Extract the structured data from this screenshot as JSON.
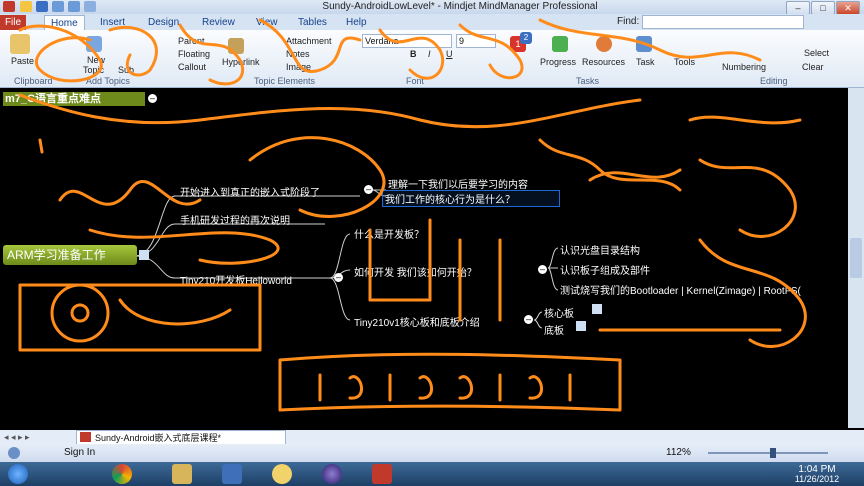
{
  "window": {
    "title": "Sundy-AndroidLowLevel* - Mindjet MindManager Professional",
    "buttons": [
      "–",
      "□",
      "✕"
    ]
  },
  "ribbon": {
    "tabs": [
      "File",
      "Home",
      "Insert",
      "Design",
      "Review",
      "View",
      "Tables",
      "Help"
    ],
    "find_label": "Find:",
    "clipboard": {
      "paste": "Paste",
      "group": "Clipboard"
    },
    "new_topic": {
      "new_line1": "New",
      "new_line2": "Topic",
      "sub_label": "Sub",
      "group": "Add Topics"
    },
    "topic_elements": {
      "parent": "Parent",
      "floating": "Floating",
      "callout": "Callout",
      "hyperlink": "Hyperlink",
      "attachment": "Attachment",
      "notes": "Notes",
      "image": "Image",
      "group": "Topic Elements"
    },
    "font": {
      "name": "Verdana",
      "size": "9",
      "bold": "B",
      "italic": "I",
      "underline": "U",
      "group": "Font"
    },
    "tasks": {
      "priority_badges": [
        "1",
        "2"
      ],
      "progress": "Progress",
      "resources": "Resources",
      "task": "Task",
      "group": "Tasks"
    },
    "editing": {
      "tools": "Tools",
      "select": "Select",
      "numbering": "Numbering",
      "clear": "Clear",
      "group": "Editing"
    },
    "accent_color": "#15428b"
  },
  "map": {
    "central_topic": "ARM学习准备工作",
    "header_topic": "m7_C语言重点难点",
    "topics": {
      "t1": "开始进入到真正的嵌入式阶段了",
      "t1_sub1": "理解一下我们以后要学习的内容",
      "t1_sub2": "我们工作的核心行为是什么？",
      "t2": "手机研发过程的再次说明",
      "t3": "Tiny210开发板Helloworld",
      "t3_sub1": "什么是开发板？",
      "t3_sub2": "如何开发 我们该如何开始？",
      "t3_sub2_a": "认识光盘目录结构",
      "t3_sub2_b": "认识板子组成及部件",
      "t3_sub2_c": "测试烧写我们的Bootloader | Kernel(Zimage) | RootFS(",
      "t3_sub3": "Tiny210v1核心板和底板介绍",
      "t3_sub3_a": "核心板",
      "t3_sub3_b": "底板"
    }
  },
  "statusbar": {
    "doc_tab": "Sundy-Android嵌入式底层课程*",
    "sign_in": "Sign In",
    "zoom": "112%"
  },
  "taskbar": {
    "time": "1:04 PM",
    "date": "11/26/2012"
  },
  "colors": {
    "annotation": "#ff8c1a",
    "central_topic_bg": "#6d8a1a",
    "selected_topic": "#1e6bd6"
  }
}
